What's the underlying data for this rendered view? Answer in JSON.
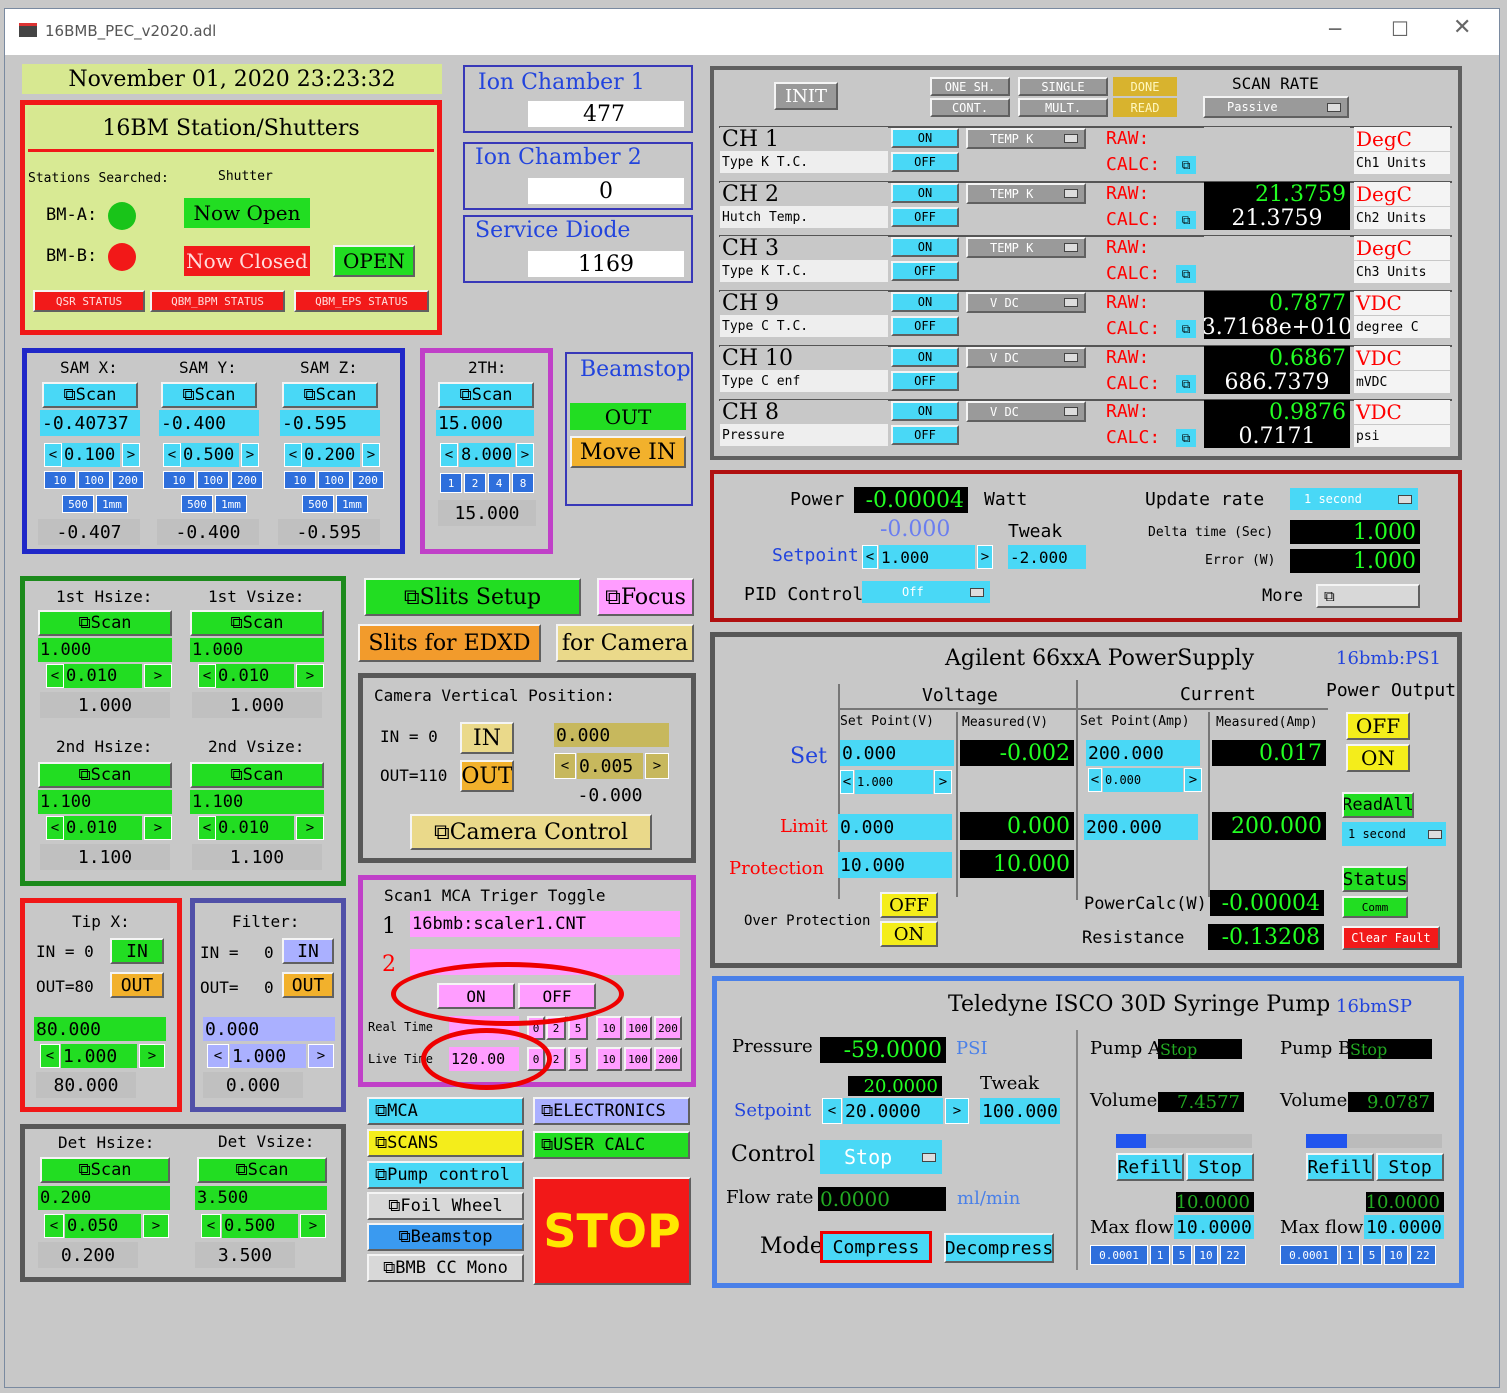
{
  "window": {
    "title": "16BMB_PEC_v2020.adl"
  },
  "date": "November 01, 2020 23:23:32",
  "station": {
    "title": "16BM Station/Shutters",
    "searched": "Stations Searched:",
    "shutter": "Shutter",
    "bma": "BM-A:",
    "bmb": "BM-B:",
    "a_status": "Now Open",
    "b_status": "Now Closed",
    "open_btn": "OPEN",
    "btns": [
      "QSR STATUS",
      "QBM_BPM STATUS",
      "QBM_EPS STATUS"
    ]
  },
  "ion1": {
    "label": "Ion Chamber 1",
    "value": "477"
  },
  "ion2": {
    "label": "Ion Chamber 2",
    "value": "0"
  },
  "diode": {
    "label": "Service Diode",
    "value": "1169"
  },
  "scan": {
    "init": "INIT",
    "one_sh": "ONE SH.",
    "single": "SINGLE",
    "done": "DONE",
    "cont": "CONT.",
    "mult": "MULT.",
    "read": "READ",
    "rate_label": "SCAN RATE",
    "rate": "Passive",
    "channels": [
      {
        "ch": "CH 1",
        "type": "Type K T.C.",
        "on": "ON",
        "off": "OFF",
        "mode": "TEMP K",
        "raw": "RAW:",
        "calc": "CALC:",
        "rawv": "",
        "calcv": "",
        "unit": "DegC",
        "units2": "Ch1 Units"
      },
      {
        "ch": "CH 2",
        "type": "Hutch Temp.",
        "on": "ON",
        "off": "OFF",
        "mode": "TEMP K",
        "raw": "RAW:",
        "calc": "CALC:",
        "rawv": "21.3759",
        "calcv": "21.3759",
        "unit": "DegC",
        "units2": "Ch2 Units"
      },
      {
        "ch": "CH 3",
        "type": "Type K T.C.",
        "on": "ON",
        "off": "OFF",
        "mode": "TEMP K",
        "raw": "RAW:",
        "calc": "CALC:",
        "rawv": "",
        "calcv": "",
        "unit": "DegC",
        "units2": "Ch3 Units"
      },
      {
        "ch": "CH 9",
        "type": "Type C T.C.",
        "on": "ON",
        "off": "OFF",
        "mode": "V DC",
        "raw": "RAW:",
        "calc": "CALC:",
        "rawv": "0.7877",
        "calcv": "3.7168e+010",
        "unit": "VDC",
        "units2": "degree C"
      },
      {
        "ch": "CH 10",
        "type": "Type C enf",
        "on": "ON",
        "off": "OFF",
        "mode": "V DC",
        "raw": "RAW:",
        "calc": "CALC:",
        "rawv": "0.6867",
        "calcv": "686.7379",
        "unit": "VDC",
        "units2": "mVDC"
      },
      {
        "ch": "CH 8",
        "type": "Pressure",
        "on": "ON",
        "off": "OFF",
        "mode": "V DC",
        "raw": "RAW:",
        "calc": "CALC:",
        "rawv": "0.9876",
        "calcv": "0.7171",
        "unit": "VDC",
        "units2": "psi"
      }
    ]
  },
  "pid": {
    "power": "Power",
    "power_v": "-0.00004",
    "watt": "Watt",
    "update": "Update rate",
    "update_v": "1 second",
    "setpoint_disp": "-0.000",
    "tweak": "Tweak",
    "setpoint": "Setpoint",
    "sp_v": "1.000",
    "tw_v": "-2.000",
    "delta": "Delta time (Sec)",
    "delta_v": "1.000",
    "error": "Error (W)",
    "error_v": "1.000",
    "pid_ctrl": "PID Control",
    "pid_v": "Off",
    "more": "More"
  },
  "sam": {
    "x_label": "SAM X:",
    "y_label": "SAM Y:",
    "z_label": "SAM Z:",
    "scan": "Scan",
    "x": "-0.40737",
    "y": "-0.400",
    "z": "-0.595",
    "xs": "0.100",
    "ys": "0.500",
    "zs": "0.200",
    "xr": "-0.407",
    "yr": "-0.400",
    "zr": "-0.595",
    "steps1": [
      "10",
      "100",
      "200"
    ],
    "steps2": [
      "500",
      "1mm"
    ]
  },
  "tth": {
    "label": "2TH:",
    "scan": "Scan",
    "v": "15.000",
    "s": "8.000",
    "steps": [
      "1",
      "2",
      "4",
      "8"
    ],
    "r": "15.000"
  },
  "beamstop": {
    "label": "Beamstop",
    "out": "OUT",
    "move": "Move IN"
  },
  "slits": {
    "h1": "1st Hsize:",
    "v1": "1st Vsize:",
    "h2": "2nd Hsize:",
    "v2": "2nd Vsize:",
    "scan": "Scan",
    "h1v": "1.000",
    "v1v": "1.000",
    "h1s": "0.010",
    "v1s": "0.010",
    "h1r": "1.000",
    "v1r": "1.000",
    "h2v": "1.100",
    "v2v": "1.100",
    "h2s": "0.010",
    "v2s": "0.010",
    "h2r": "1.100",
    "v2r": "1.100"
  },
  "slitsbtns": {
    "setup": "Slits Setup",
    "focus": "Focus",
    "edxd": "Slits for EDXD",
    "camera": "for Camera"
  },
  "camvert": {
    "title": "Camera Vertical Position:",
    "in_eq": "IN = 0",
    "out_eq": "OUT=110",
    "in": "IN",
    "out": "OUT",
    "v": "0.000",
    "s": "0.005",
    "r": "-0.000",
    "ctrl": "Camera Control"
  },
  "mca": {
    "title": "Scan1 MCA Triger Toggle",
    "n1": "1",
    "n2": "2",
    "pv1": "16bmb:scaler1.CNT",
    "pv2": "",
    "on": "ON",
    "off": "OFF",
    "realtime": "Real Time",
    "livetime": "Live Time",
    "live_v": "120.00",
    "steps": [
      "2",
      "5",
      "10",
      "100",
      "200"
    ]
  },
  "agilent": {
    "title": "Agilent 66xxA PowerSupply",
    "pv": "16bmb:PS1",
    "voltage": "Voltage",
    "current": "Current",
    "pout": "Power Output",
    "sp_v": "Set Point(V)",
    "meas_v": "Measured(V)",
    "sp_a": "Set Point(Amp)",
    "meas_a": "Measured(Amp)",
    "set": "Set",
    "limit": "Limit",
    "protection": "Protection",
    "set_v": "0.000",
    "set_mv": "-0.002",
    "set_a": "200.000",
    "set_ma": "0.017",
    "tw_v": "1.000",
    "tw_a": "0.000",
    "lim_v": "0.000",
    "lim_mv": "0.000",
    "lim_a": "200.000",
    "lim_ma": "200.000",
    "prot_v": "10.000",
    "prot_mv": "10.000",
    "off": "OFF",
    "on": "ON",
    "readall": "ReadAll",
    "rate": "1 second",
    "status": "Status",
    "comm": "Comm",
    "overprot": "Over Protection",
    "powercalc": "PowerCalc(W)",
    "pc_v": "-0.00004",
    "resistance": "Resistance",
    "res_v": "-0.13208",
    "clear": "Clear Fault"
  },
  "tip": {
    "label": "Tip X:",
    "in_eq": "IN = 0",
    "out_eq": "OUT=80",
    "in": "IN",
    "out": "OUT",
    "v": "80.000",
    "s": "1.000",
    "r": "80.000"
  },
  "filter": {
    "label": "Filter:",
    "in_eq": "IN =",
    "in_n": "0",
    "out_eq": "OUT=",
    "out_n": "0",
    "in": "IN",
    "out": "OUT",
    "v": "0.000",
    "s": "1.000",
    "r": "0.000"
  },
  "det": {
    "h": "Det Hsize:",
    "v": "Det Vsize:",
    "scan": "Scan",
    "hv": "0.200",
    "vv": "3.500",
    "hs": "0.050",
    "vs": "0.500",
    "hr": "0.200",
    "vr": "3.500"
  },
  "links": {
    "mca": "MCA",
    "electronics": "ELECTRONICS",
    "scans": "SCANS",
    "usercalc": "USER CALC",
    "pump": "Pump control",
    "foil": "Foil Wheel",
    "beamstop": "Beamstop",
    "bmbcc": "BMB CC Mono",
    "stop": "STOP"
  },
  "isco": {
    "title": "Teledyne ISCO 30D Syringe Pump",
    "pv": "16bmSP",
    "pressure": "Pressure",
    "p_v": "-59.0000",
    "psi": "PSI",
    "sp_disp": "20.0000",
    "tweak": "Tweak",
    "setpoint": "Setpoint",
    "sp_v": "20.0000",
    "tw_v": "100.000",
    "control": "Control",
    "ctrl_v": "Stop",
    "flow": "Flow rate",
    "flow_v": "0.0000",
    "mlmin": "ml/min",
    "mode": "Mode",
    "compress": "Compress",
    "decompress": "Decompress",
    "pumpA": {
      "label": "Pump A",
      "state": "Stop",
      "volume": "Volume",
      "vol_v": "7.4577",
      "refill": "Refill",
      "stop": "Stop",
      "maxflow_disp": "10.0000",
      "maxflow": "Max flow",
      "mf_v": "10.0000",
      "steps": [
        "0.0001",
        "1",
        "5",
        "10",
        "22"
      ],
      "fill": 0.22
    },
    "pumpB": {
      "label": "Pump B",
      "state": "Stop",
      "volume": "Volume",
      "vol_v": "9.0787",
      "refill": "Refill",
      "stop": "Stop",
      "maxflow_disp": "10.0000",
      "maxflow": "Max flow",
      "mf_v": "10.0000",
      "steps": [
        "0.0001",
        "1",
        "5",
        "10",
        "22"
      ],
      "fill": 0.3
    }
  }
}
